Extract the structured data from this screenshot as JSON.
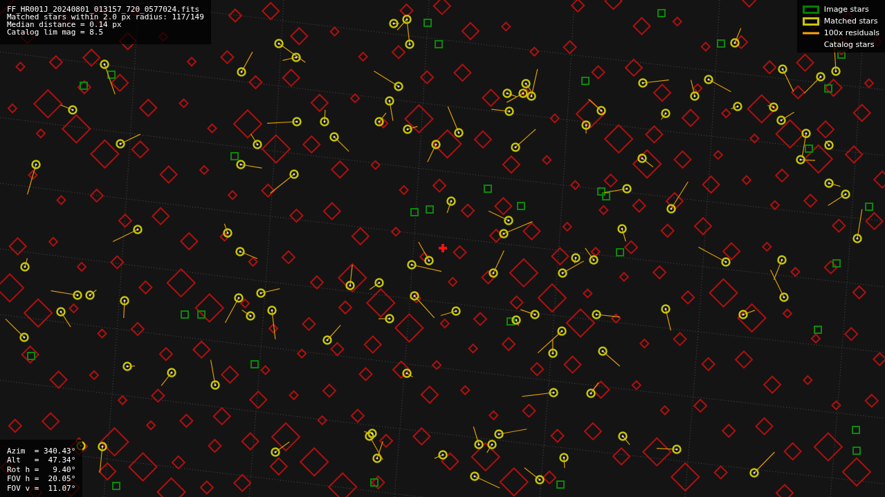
{
  "info_lines": [
    "FF_HR001J_20240801_013157_720_0577024.fits",
    "Matched stars within 2.0 px radius: 117/149",
    "Median distance = 0.14 px",
    "Catalog lim mag = 8.5"
  ],
  "legend": [
    {
      "label": "Image stars",
      "kind": "box",
      "color": "#008000"
    },
    {
      "label": "Matched stars",
      "kind": "box",
      "color": "#c8c800"
    },
    {
      "label": "100x residuals",
      "kind": "line",
      "color": "#ffa500"
    },
    {
      "label": "Catalog stars",
      "kind": "none"
    }
  ],
  "pointing": [
    "Azim  = 340.43°",
    "Alt   =  47.34°",
    "Rot h =   9.40°",
    "FOV h =  20.05°",
    "FOV v =  11.07°"
  ]
}
